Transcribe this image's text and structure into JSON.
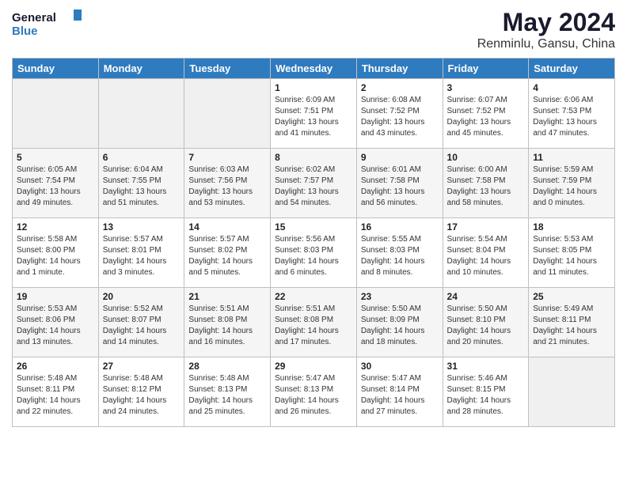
{
  "header": {
    "logo_line1": "General",
    "logo_line2": "Blue",
    "title": "May 2024",
    "subtitle": "Renminlu, Gansu, China"
  },
  "days_of_week": [
    "Sunday",
    "Monday",
    "Tuesday",
    "Wednesday",
    "Thursday",
    "Friday",
    "Saturday"
  ],
  "weeks": [
    [
      {
        "day": "",
        "info": ""
      },
      {
        "day": "",
        "info": ""
      },
      {
        "day": "",
        "info": ""
      },
      {
        "day": "1",
        "info": "Sunrise: 6:09 AM\nSunset: 7:51 PM\nDaylight: 13 hours\nand 41 minutes."
      },
      {
        "day": "2",
        "info": "Sunrise: 6:08 AM\nSunset: 7:52 PM\nDaylight: 13 hours\nand 43 minutes."
      },
      {
        "day": "3",
        "info": "Sunrise: 6:07 AM\nSunset: 7:52 PM\nDaylight: 13 hours\nand 45 minutes."
      },
      {
        "day": "4",
        "info": "Sunrise: 6:06 AM\nSunset: 7:53 PM\nDaylight: 13 hours\nand 47 minutes."
      }
    ],
    [
      {
        "day": "5",
        "info": "Sunrise: 6:05 AM\nSunset: 7:54 PM\nDaylight: 13 hours\nand 49 minutes."
      },
      {
        "day": "6",
        "info": "Sunrise: 6:04 AM\nSunset: 7:55 PM\nDaylight: 13 hours\nand 51 minutes."
      },
      {
        "day": "7",
        "info": "Sunrise: 6:03 AM\nSunset: 7:56 PM\nDaylight: 13 hours\nand 53 minutes."
      },
      {
        "day": "8",
        "info": "Sunrise: 6:02 AM\nSunset: 7:57 PM\nDaylight: 13 hours\nand 54 minutes."
      },
      {
        "day": "9",
        "info": "Sunrise: 6:01 AM\nSunset: 7:58 PM\nDaylight: 13 hours\nand 56 minutes."
      },
      {
        "day": "10",
        "info": "Sunrise: 6:00 AM\nSunset: 7:58 PM\nDaylight: 13 hours\nand 58 minutes."
      },
      {
        "day": "11",
        "info": "Sunrise: 5:59 AM\nSunset: 7:59 PM\nDaylight: 14 hours\nand 0 minutes."
      }
    ],
    [
      {
        "day": "12",
        "info": "Sunrise: 5:58 AM\nSunset: 8:00 PM\nDaylight: 14 hours\nand 1 minute."
      },
      {
        "day": "13",
        "info": "Sunrise: 5:57 AM\nSunset: 8:01 PM\nDaylight: 14 hours\nand 3 minutes."
      },
      {
        "day": "14",
        "info": "Sunrise: 5:57 AM\nSunset: 8:02 PM\nDaylight: 14 hours\nand 5 minutes."
      },
      {
        "day": "15",
        "info": "Sunrise: 5:56 AM\nSunset: 8:03 PM\nDaylight: 14 hours\nand 6 minutes."
      },
      {
        "day": "16",
        "info": "Sunrise: 5:55 AM\nSunset: 8:03 PM\nDaylight: 14 hours\nand 8 minutes."
      },
      {
        "day": "17",
        "info": "Sunrise: 5:54 AM\nSunset: 8:04 PM\nDaylight: 14 hours\nand 10 minutes."
      },
      {
        "day": "18",
        "info": "Sunrise: 5:53 AM\nSunset: 8:05 PM\nDaylight: 14 hours\nand 11 minutes."
      }
    ],
    [
      {
        "day": "19",
        "info": "Sunrise: 5:53 AM\nSunset: 8:06 PM\nDaylight: 14 hours\nand 13 minutes."
      },
      {
        "day": "20",
        "info": "Sunrise: 5:52 AM\nSunset: 8:07 PM\nDaylight: 14 hours\nand 14 minutes."
      },
      {
        "day": "21",
        "info": "Sunrise: 5:51 AM\nSunset: 8:08 PM\nDaylight: 14 hours\nand 16 minutes."
      },
      {
        "day": "22",
        "info": "Sunrise: 5:51 AM\nSunset: 8:08 PM\nDaylight: 14 hours\nand 17 minutes."
      },
      {
        "day": "23",
        "info": "Sunrise: 5:50 AM\nSunset: 8:09 PM\nDaylight: 14 hours\nand 18 minutes."
      },
      {
        "day": "24",
        "info": "Sunrise: 5:50 AM\nSunset: 8:10 PM\nDaylight: 14 hours\nand 20 minutes."
      },
      {
        "day": "25",
        "info": "Sunrise: 5:49 AM\nSunset: 8:11 PM\nDaylight: 14 hours\nand 21 minutes."
      }
    ],
    [
      {
        "day": "26",
        "info": "Sunrise: 5:48 AM\nSunset: 8:11 PM\nDaylight: 14 hours\nand 22 minutes."
      },
      {
        "day": "27",
        "info": "Sunrise: 5:48 AM\nSunset: 8:12 PM\nDaylight: 14 hours\nand 24 minutes."
      },
      {
        "day": "28",
        "info": "Sunrise: 5:48 AM\nSunset: 8:13 PM\nDaylight: 14 hours\nand 25 minutes."
      },
      {
        "day": "29",
        "info": "Sunrise: 5:47 AM\nSunset: 8:13 PM\nDaylight: 14 hours\nand 26 minutes."
      },
      {
        "day": "30",
        "info": "Sunrise: 5:47 AM\nSunset: 8:14 PM\nDaylight: 14 hours\nand 27 minutes."
      },
      {
        "day": "31",
        "info": "Sunrise: 5:46 AM\nSunset: 8:15 PM\nDaylight: 14 hours\nand 28 minutes."
      },
      {
        "day": "",
        "info": ""
      }
    ]
  ]
}
